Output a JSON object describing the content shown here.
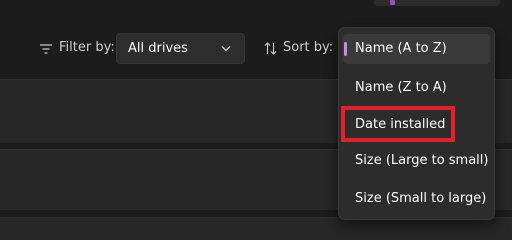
{
  "filter": {
    "label": "Filter by:",
    "selected": "All drives",
    "icon": "filter-icon"
  },
  "sort": {
    "label": "Sort by:",
    "icon": "sort-icon",
    "options": [
      {
        "label": "Name (A to Z)",
        "selected": true
      },
      {
        "label": "Name (Z to A)",
        "selected": false
      },
      {
        "label": "Date installed",
        "selected": false
      },
      {
        "label": "Size (Large to small)",
        "selected": false
      },
      {
        "label": "Size (Small to large)",
        "selected": false
      }
    ]
  },
  "colors": {
    "accent": "#c58fd6",
    "highlight": "#e0202b",
    "background": "#1c1c1c",
    "panel": "#272727",
    "menu": "#2c2c2c"
  }
}
